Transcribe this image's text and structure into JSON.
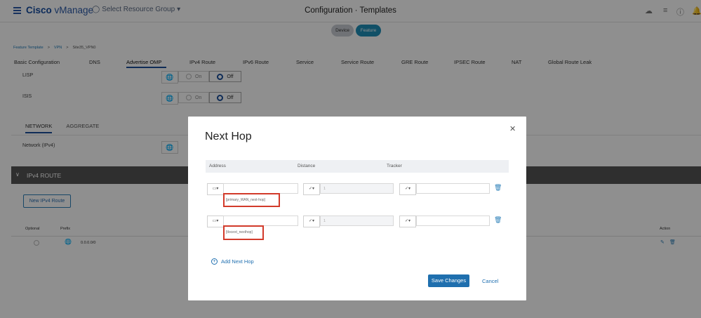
{
  "topbar": {
    "brand_bold": "Cisco",
    "brand_rest": " vManage",
    "resource_group": "Select Resource Group",
    "title": "Configuration · Templates",
    "icons": [
      "cloud-icon",
      "menu-icon",
      "help-icon",
      "bell-icon"
    ]
  },
  "pills": {
    "device": "Device",
    "feature": "Feature"
  },
  "breadcrumb": {
    "item1": "Feature Template",
    "sep": ">",
    "item2": "VPN",
    "item3": "Site35_VPN0"
  },
  "tabs": [
    "Basic Configuration",
    "DNS",
    "Advertise OMP",
    "IPv4 Route",
    "IPv6 Route",
    "Service",
    "Service Route",
    "GRE Route",
    "IPSEC Route",
    "NAT",
    "Global Route Leak"
  ],
  "form": {
    "lisp_label": "LISP",
    "isis_label": "ISIS",
    "on_label": "On",
    "off_label": "Off",
    "subtab_network": "NETWORK",
    "subtab_aggregate": "AGGREGATE",
    "network_ipv4_label": "Network (IPv4)",
    "ipv4_route_header": "IPv4 ROUTE",
    "new_ipv4_route": "New IPv4 Route",
    "col_optional": "Optional",
    "col_prefix": "Prefix",
    "col_action": "Action",
    "row_prefix": "0.0.0.0/0"
  },
  "modal": {
    "title": "Next Hop",
    "col_address": "Address",
    "col_distance": "Distance",
    "col_tracker": "Tracker",
    "rows": [
      {
        "address_var": "[primary_WAN_next-hop]",
        "distance_placeholder": "1"
      },
      {
        "address_var": "[tlocext_nexthop]",
        "distance_placeholder": "1"
      }
    ],
    "add_next_hop": "Add Next Hop",
    "save": "Save Changes",
    "cancel": "Cancel"
  },
  "colors": {
    "primary": "#1f6fae",
    "brand": "#174da1",
    "highlight": "#d23a2a",
    "dark_bar": "#545454"
  }
}
